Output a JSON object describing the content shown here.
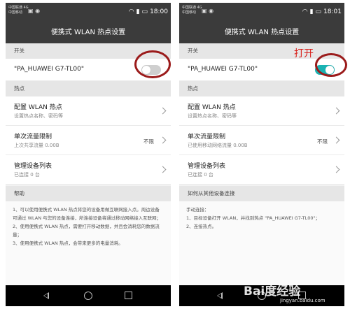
{
  "left": {
    "status": {
      "carrier1": "中国联通 4G",
      "carrier2": "中国移动",
      "time": "18:00"
    },
    "title": "便携式 WLAN 热点设置",
    "switch_header": "开关",
    "ssid": "\"PA_HUAWEI G7-TL00\"",
    "toggle_on": false,
    "hotspot_header": "热点",
    "config": {
      "title": "配置 WLAN 热点",
      "sub": "设置热点名称、密码等"
    },
    "limit": {
      "title": "单次流量限制",
      "sub": "上次共享流量 0.00B",
      "value": "不限"
    },
    "devices": {
      "title": "管理设备列表",
      "sub": "已连接 0 台"
    },
    "help_header": "帮助",
    "help_lines": [
      "1、可以使用便携式 WLAN 热点将您的设备用做互联网接入点。周边设备可通过 WLAN 与您的设备连接，所连接设备将通过移动网络接入互联网；",
      "2、使用便携式 WLAN 热点，需要打开移动数据，并且会消耗您的数据流量；",
      "3、使用便携式 WLAN 热点，会带来更多的电量消耗。"
    ]
  },
  "right": {
    "status": {
      "carrier1": "中国联通 4G",
      "carrier2": "中国移动",
      "time": "18:01"
    },
    "title": "便携式 WLAN 热点设置",
    "switch_header": "开关",
    "ssid": "\"PA_HUAWEI G7-TL00\"",
    "toggle_on": true,
    "hotspot_header": "热点",
    "config": {
      "title": "配置 WLAN 热点",
      "sub": "设置热点名称、密码等"
    },
    "limit": {
      "title": "单次流量限制",
      "sub": "已使用移动网络流量 0.00B",
      "value": "不限"
    },
    "devices": {
      "title": "管理设备列表",
      "sub": "已连接 0 台"
    },
    "help_header": "如何从其他设备连接",
    "help_lines": [
      "手动连接：",
      "1、目标设备打开 WLAN，并找到热点 \"PA_HUAWEI G7-TL00\"；",
      "2、连接热点。"
    ]
  },
  "annotation": "打开",
  "watermark": {
    "brand": "Bai度经验",
    "url": "jingyan.baidu.com"
  },
  "colors": {
    "toggle_on": "#1ab3b3",
    "highlight_ring": "#9b1b1b",
    "annotation": "#d9211b",
    "header_bar": "#3b3b3b"
  },
  "icons": {
    "nav_back": "back-triangle-icon",
    "nav_home": "home-circle-icon",
    "nav_recent": "recent-square-icon"
  }
}
